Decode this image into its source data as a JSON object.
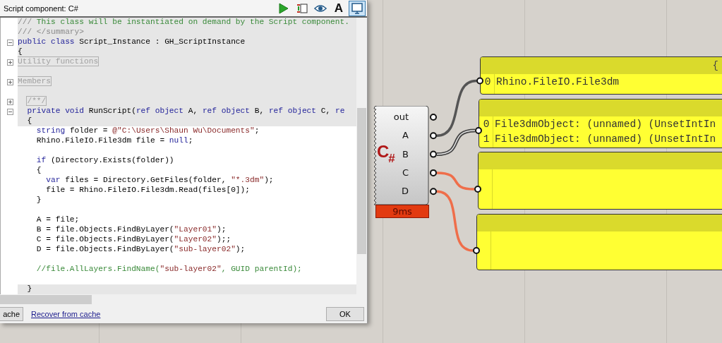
{
  "dialog": {
    "title": "Script component: C#",
    "toolbar": [
      {
        "kind": "run",
        "on": false
      },
      {
        "kind": "sync",
        "on": false
      },
      {
        "kind": "preview",
        "on": false
      },
      {
        "kind": "font",
        "label": "A",
        "on": false
      },
      {
        "kind": "window",
        "on": true
      }
    ],
    "code": {
      "lines": [
        {
          "kind": "code",
          "shaded": true,
          "segments": [
            {
              "text": "/// ",
              "kind": "doc"
            },
            {
              "text": "This class will be instantiated on demand by the Script component.",
              "kind": "comment"
            }
          ]
        },
        {
          "kind": "code",
          "shaded": true,
          "segments": [
            {
              "text": "/// </summary>",
              "kind": "doc"
            }
          ]
        },
        {
          "kind": "code",
          "shaded": true,
          "fold": {
            "expanded": true
          },
          "segments": [
            {
              "text": "public class",
              "kind": "keyword"
            },
            {
              "text": " Script_Instance : GH_ScriptInstance",
              "kind": "plain"
            }
          ]
        },
        {
          "kind": "code",
          "shaded": true,
          "segments": [
            {
              "text": "{",
              "kind": "plain"
            }
          ]
        },
        {
          "kind": "code",
          "shaded": true,
          "fold": {
            "expanded": false
          },
          "segments": [
            {
              "text": "Utility functions",
              "kind": "region"
            }
          ]
        },
        {
          "kind": "blank",
          "shaded": true
        },
        {
          "kind": "code",
          "shaded": true,
          "fold": {
            "expanded": false
          },
          "segments": [
            {
              "text": "Members",
              "kind": "region"
            }
          ]
        },
        {
          "kind": "blank",
          "shaded": true
        },
        {
          "kind": "code",
          "shaded": true,
          "fold": {
            "expanded": false
          },
          "segments": [
            {
              "text": "  /**/",
              "kind": "region"
            }
          ]
        },
        {
          "kind": "code",
          "shaded": true,
          "fold": {
            "expanded": true
          },
          "segments": [
            {
              "text": "  private void",
              "kind": "keyword"
            },
            {
              "text": " RunScript(",
              "kind": "plain"
            },
            {
              "text": "ref object",
              "kind": "keyword"
            },
            {
              "text": " A, ",
              "kind": "plain"
            },
            {
              "text": "ref object",
              "kind": "keyword"
            },
            {
              "text": " B, ",
              "kind": "plain"
            },
            {
              "text": "ref object",
              "kind": "keyword"
            },
            {
              "text": " C, ",
              "kind": "plain"
            },
            {
              "text": "re",
              "kind": "keyword"
            }
          ]
        },
        {
          "kind": "code",
          "shaded": true,
          "segments": [
            {
              "text": "  {",
              "kind": "plain"
            }
          ]
        },
        {
          "kind": "code",
          "shaded": false,
          "segments": [
            {
              "text": "    string",
              "kind": "keyword"
            },
            {
              "text": " folder = ",
              "kind": "plain"
            },
            {
              "text": "@\"C:\\Users\\Shaun Wu\\Documents\"",
              "kind": "string"
            },
            {
              "text": ";",
              "kind": "plain"
            }
          ]
        },
        {
          "kind": "code",
          "shaded": false,
          "segments": [
            {
              "text": "    Rhino.FileIO.File3dm file = ",
              "kind": "plain"
            },
            {
              "text": "null",
              "kind": "keyword"
            },
            {
              "text": ";",
              "kind": "plain"
            }
          ]
        },
        {
          "kind": "blank",
          "shaded": false
        },
        {
          "kind": "code",
          "shaded": false,
          "segments": [
            {
              "text": "    if",
              "kind": "keyword"
            },
            {
              "text": " (Directory.Exists(folder))",
              "kind": "plain"
            }
          ]
        },
        {
          "kind": "code",
          "shaded": false,
          "segments": [
            {
              "text": "    {",
              "kind": "plain"
            }
          ]
        },
        {
          "kind": "code",
          "shaded": false,
          "segments": [
            {
              "text": "      var",
              "kind": "keyword"
            },
            {
              "text": " files = Directory.GetFiles(folder, ",
              "kind": "plain"
            },
            {
              "text": "\"*.3dm\"",
              "kind": "string"
            },
            {
              "text": ");",
              "kind": "plain"
            }
          ]
        },
        {
          "kind": "code",
          "shaded": false,
          "segments": [
            {
              "text": "      file = Rhino.FileIO.File3dm.Read(files[0]);",
              "kind": "plain"
            }
          ]
        },
        {
          "kind": "code",
          "shaded": false,
          "segments": [
            {
              "text": "    }",
              "kind": "plain"
            }
          ]
        },
        {
          "kind": "blank",
          "shaded": false
        },
        {
          "kind": "code",
          "shaded": false,
          "segments": [
            {
              "text": "    A = file;",
              "kind": "plain"
            }
          ]
        },
        {
          "kind": "code",
          "shaded": false,
          "segments": [
            {
              "text": "    B = file.Objects.FindByLayer(",
              "kind": "plain"
            },
            {
              "text": "\"Layer01\"",
              "kind": "string"
            },
            {
              "text": ");",
              "kind": "plain"
            }
          ]
        },
        {
          "kind": "code",
          "shaded": false,
          "segments": [
            {
              "text": "    C = file.Objects.FindByLayer(",
              "kind": "plain"
            },
            {
              "text": "\"Layer02\"",
              "kind": "string"
            },
            {
              "text": ");;",
              "kind": "plain"
            }
          ]
        },
        {
          "kind": "code",
          "shaded": false,
          "segments": [
            {
              "text": "    D = file.Objects.FindByLayer(",
              "kind": "plain"
            },
            {
              "text": "\"sub-layer02\"",
              "kind": "string"
            },
            {
              "text": ");",
              "kind": "plain"
            }
          ]
        },
        {
          "kind": "blank",
          "shaded": false
        },
        {
          "kind": "code",
          "shaded": false,
          "segments": [
            {
              "text": "    //file.AllLayers.FindName(",
              "kind": "comment"
            },
            {
              "text": "\"sub-layer02\"",
              "kind": "string"
            },
            {
              "text": ", GUID parentId);",
              "kind": "comment"
            }
          ]
        },
        {
          "kind": "blank",
          "shaded": false
        },
        {
          "kind": "code",
          "shaded": true,
          "segments": [
            {
              "text": "  }",
              "kind": "plain"
            }
          ]
        }
      ]
    },
    "footer": {
      "cache_button": "ache",
      "recover_link": "Recover from cache",
      "ok_button": "OK"
    }
  },
  "canvas": {
    "component": {
      "logo": {
        "letter": "C",
        "mark": "#"
      },
      "timer": "9ms",
      "outputs": [
        {
          "label": "out"
        },
        {
          "label": "A",
          "wire": {
            "kind": "item"
          },
          "panel": {
            "header": "{",
            "items": [
              {
                "index": "0",
                "text": "Rhino.FileIO.File3dm"
              }
            ]
          }
        },
        {
          "label": "B",
          "wire": {
            "kind": "list"
          },
          "panel": {
            "items": [
              {
                "index": "0",
                "text": "File3dmObject: (unnamed) (UnsetIntIn"
              },
              {
                "index": "1",
                "text": "File3dmObject: (unnamed) (UnsetIntIn"
              }
            ]
          }
        },
        {
          "label": "C",
          "wire": {
            "kind": "null"
          }
        },
        {
          "label": "D",
          "wire": {
            "kind": "null"
          }
        }
      ]
    }
  }
}
